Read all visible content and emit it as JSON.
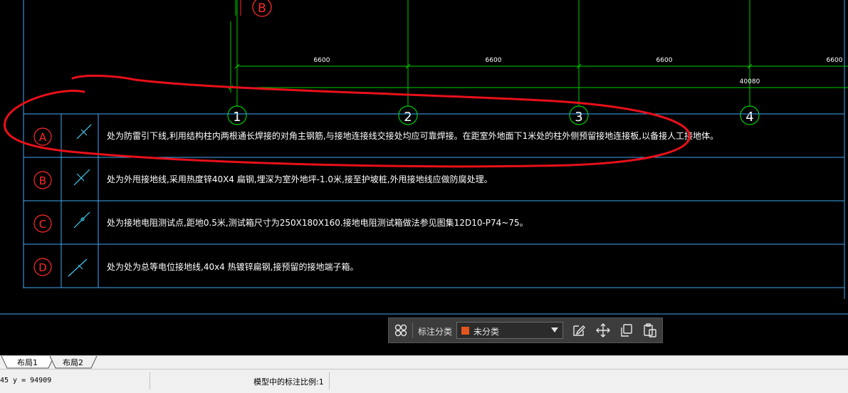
{
  "drawing": {
    "top_axis_label": "B",
    "dimensions": [
      "6600",
      "6600",
      "6600",
      "6600"
    ],
    "total_dimension": "40080",
    "grid_axes": [
      "1",
      "2",
      "3",
      "4"
    ],
    "legend": [
      {
        "label": "A",
        "text": "处为防雷引下线,利用结构柱内两根通长焊接的对角主钢筋,与接地连接线交接处均应可靠焊接。在距室外地面下1米处的柱外侧预留接地连接板,以备接人工接地体。"
      },
      {
        "label": "B",
        "text": "处为外甩接地线,采用热度锌40X4 扁钢,埋深为室外地坪-1.0米,接至护坡桩,外甩接地线应做防腐处理。"
      },
      {
        "label": "C",
        "text": "处为接地电阻测试点,距地0.5米,测试箱尺寸为250X180X160.接地电阻测试箱做法参见图集12D10-P74~75。"
      },
      {
        "label": "D",
        "text": "处为处为总等电位接地线,40x4 热镀锌扁钢,接预留的接地端子箱。"
      }
    ],
    "colors": {
      "axis_circle": "#ff2a2a",
      "grid_line": "#00cc00",
      "table_line": "#3fa9f5",
      "markup": "#e8101a",
      "text": "#ffffff"
    }
  },
  "toolbar": {
    "label": "标注分类",
    "category_value": "未分类",
    "category_color": "#e2571e",
    "icons": [
      "grid-icon",
      "edit-icon",
      "move-icon",
      "copy-icon",
      "paste-icon"
    ]
  },
  "tabs": [
    "布局1",
    "布局2"
  ],
  "status": {
    "coords": "45 y = 94909",
    "scale_label": "模型中的标注比例:1"
  }
}
